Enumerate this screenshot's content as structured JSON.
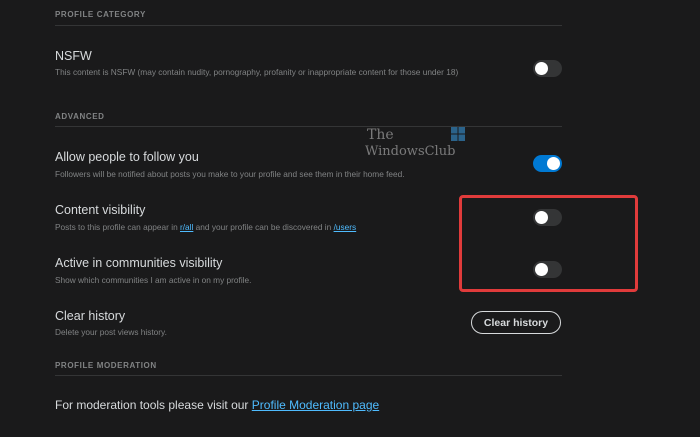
{
  "sections": {
    "profile_category": "PROFILE CATEGORY",
    "advanced": "ADVANCED",
    "profile_moderation": "PROFILE MODERATION"
  },
  "nsfw": {
    "title": "NSFW",
    "description": "This content is NSFW (may contain nudity, pornography, profanity or inappropriate content for those under 18)",
    "enabled": false
  },
  "allow_follow": {
    "title": "Allow people to follow you",
    "description": "Followers will be notified about posts you make to your profile and see them in their home feed.",
    "enabled": true
  },
  "content_visibility": {
    "title": "Content visibility",
    "description_prefix": "Posts to this profile can appear in ",
    "link_all": "r/all",
    "description_middle": " and your profile can be discovered in ",
    "link_users": "/users",
    "enabled": false
  },
  "active_communities": {
    "title": "Active in communities visibility",
    "description": "Show which communities I am active in on my profile.",
    "enabled": false
  },
  "clear_history": {
    "title": "Clear history",
    "description": "Delete your post views history.",
    "button_label": "Clear history"
  },
  "moderation": {
    "text_prefix": "For moderation tools please visit our ",
    "link_label": "Profile Moderation page"
  },
  "watermark": {
    "line1": "The",
    "line2": "WindowsClub"
  },
  "colors": {
    "background": "#1a1a1b",
    "accent_blue": "#0079d3",
    "link_blue": "#4fbcff",
    "highlight_red": "#e03b3b"
  }
}
